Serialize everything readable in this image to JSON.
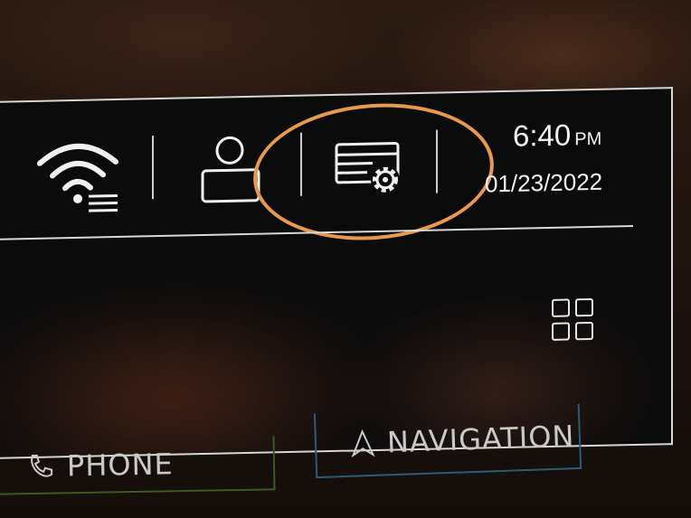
{
  "status_bar": {
    "icons": [
      "wifi-icon",
      "user-profile-icon",
      "settings-icon"
    ],
    "highlight_color": "#e8994d",
    "time": "6:40",
    "time_suffix": "PM",
    "date": "01/23/2022"
  },
  "home": {
    "apps_icon": "app-grid-icon"
  },
  "bottom_bar": {
    "phone_label": "PHONE",
    "navigation_label": "NAVIGATION",
    "phone_accent": "#3b5a1e",
    "navigation_accent": "#2d5a72"
  }
}
